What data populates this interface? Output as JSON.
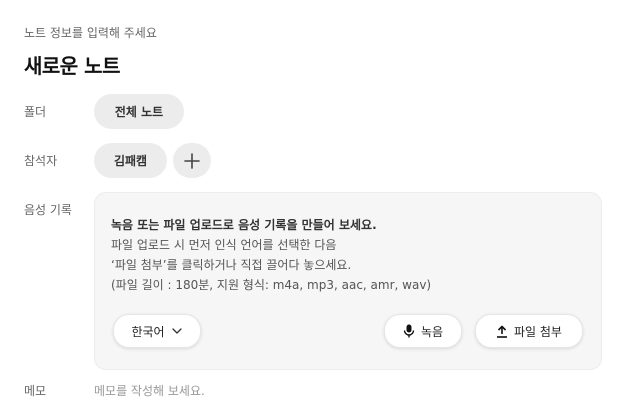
{
  "header": {
    "subtitle": "노트 정보를 입력해 주세요",
    "title": "새로운 노트"
  },
  "folder": {
    "label": "폴더",
    "value": "전체 노트"
  },
  "attendees": {
    "label": "참석자",
    "items": [
      "김패캠"
    ],
    "add_icon": "plus-icon"
  },
  "voice": {
    "label": "음성 기록",
    "lines": [
      "녹음 또는 파일 업로드로 음성 기록을 만들어 보세요.",
      "파일 업로드 시 먼저 인식 언어를 선택한 다음",
      "‘파일 첨부’를 클릭하거나 직접 끌어다 놓으세요.",
      "(파일 길이 : 180분, 지원 형식: m4a, mp3, aac, amr, wav)"
    ],
    "language": "한국어",
    "record_label": "녹음",
    "attach_label": "파일 첨부",
    "icons": {
      "language": "chevron-down-icon",
      "record": "mic-icon",
      "attach": "upload-icon"
    }
  },
  "memo": {
    "label": "메모",
    "placeholder": "메모를 작성해 보세요."
  }
}
